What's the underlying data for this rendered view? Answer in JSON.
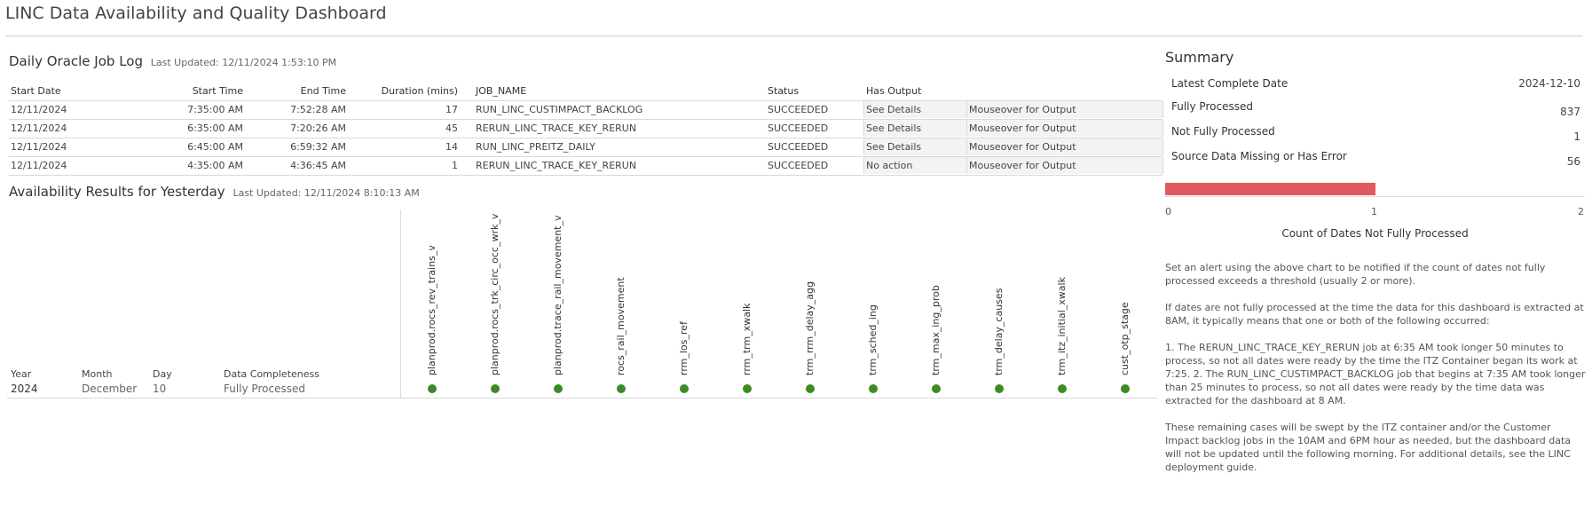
{
  "dashboard": {
    "title": "LINC Data Availability and Quality Dashboard"
  },
  "job_log": {
    "title": "Daily Oracle Job Log",
    "last_updated": "Last Updated: 12/11/2024 1:53:10 PM",
    "headers": {
      "start_date": "Start Date",
      "start_time": "Start Time",
      "end_time": "End Time",
      "duration": "Duration (mins)",
      "job_name": "JOB_NAME",
      "status": "Status",
      "has_output": "Has Output"
    },
    "rows": [
      {
        "start_date": "12/11/2024",
        "start_time": "7:35:00 AM",
        "end_time": "7:52:28 AM",
        "duration": "17",
        "job_name": "RUN_LINC_CUSTIMPACT_BACKLOG",
        "status": "SUCCEEDED",
        "has_output": "See Details",
        "output": "Mouseover for Output"
      },
      {
        "start_date": "12/11/2024",
        "start_time": "6:35:00 AM",
        "end_time": "7:20:26 AM",
        "duration": "45",
        "job_name": "RERUN_LINC_TRACE_KEY_RERUN",
        "status": "SUCCEEDED",
        "has_output": "See Details",
        "output": "Mouseover for Output"
      },
      {
        "start_date": "12/11/2024",
        "start_time": "6:45:00 AM",
        "end_time": "6:59:32 AM",
        "duration": "14",
        "job_name": "RUN_LINC_PREITZ_DAILY",
        "status": "SUCCEEDED",
        "has_output": "See Details",
        "output": "Mouseover for Output"
      },
      {
        "start_date": "12/11/2024",
        "start_time": "4:35:00 AM",
        "end_time": "4:36:45 AM",
        "duration": "1",
        "job_name": "RERUN_LINC_TRACE_KEY_RERUN",
        "status": "SUCCEEDED",
        "has_output": "No action",
        "output": "Mouseover for Output"
      }
    ]
  },
  "availability": {
    "title": "Availability Results for Yesterday",
    "last_updated": "Last Updated: 12/11/2024 8:10:13 AM",
    "headers": {
      "year": "Year",
      "month": "Month",
      "day": "Day",
      "completeness": "Data Completeness"
    },
    "row": {
      "year": "2024",
      "month": "December",
      "day": "10",
      "completeness": "Fully Processed"
    },
    "columns": [
      "planprod.rocs_rev_trains_v",
      "planprod.rocs_trk_circ_occ_wrk_v",
      "planprod.trace_rail_movement_v",
      "rocs_rail_movement",
      "rrm_los_ref",
      "rrm_trm_xwalk",
      "trm_rrm_delay_agg",
      "trm_sched_ing",
      "trm_max_ing_prob",
      "trm_delay_causes",
      "trm_itz_initial_xwalk",
      "cust_otp_stage"
    ],
    "status_dot_color": "#3c8a28"
  },
  "summary": {
    "title": "Summary",
    "items": [
      {
        "label": "Latest Complete Date",
        "value": "2024-12-10"
      },
      {
        "label": "Fully Processed",
        "value": "837"
      },
      {
        "label": "Not Fully Processed",
        "value": "1"
      },
      {
        "label": "Source Data Missing or Has Error",
        "value": "56"
      }
    ],
    "chart_data": {
      "type": "bar",
      "orientation": "horizontal",
      "values": [
        1
      ],
      "xlim": [
        0,
        2
      ],
      "ticks": [
        "0",
        "1",
        "2"
      ],
      "xlabel": "Count of Dates Not Fully Processed",
      "color": "#e05a5f"
    },
    "notes": [
      "Set an alert using the above chart to be notified if the count of dates not fully processed exceeds a threshold (usually 2 or more).",
      "If dates are not fully processed at the time the data for this dashboard is extracted at 8AM, it typically means that one or both of the following occurred:",
      "1. The RERUN_LINC_TRACE_KEY_RERUN job at 6:35 AM took longer 50 minutes to process, so not all dates were ready by the time the ITZ Container began its work at 7:25. 2. The RUN_LINC_CUSTIMPACT_BACKLOG job that begins at 7:35 AM took longer than 25 minutes to process, so not all dates were ready by the time data was extracted for the dashboard at 8 AM.",
      "These remaining cases will be swept by the ITZ container and/or  the Customer Impact backlog jobs in the 10AM and 6PM hour as needed, but the dashboard data will not be updated until the following morning. For additional details, see the LINC deployment guide."
    ]
  }
}
